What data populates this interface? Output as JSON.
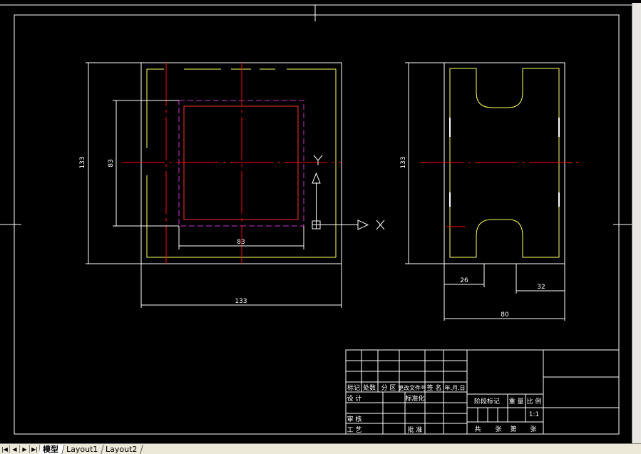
{
  "drawing": {
    "front_view": {
      "dim_height": "133",
      "dim_inner_height": "83",
      "dim_inner_width": "83",
      "dim_width": "133",
      "ucs_y": "Y",
      "ucs_x": "X"
    },
    "side_view": {
      "dim_height": "133",
      "dim_left": "26",
      "dim_right": "32",
      "dim_total": "80"
    }
  },
  "title_block": {
    "rev_headers": [
      "标记",
      "处数",
      "分 区",
      "更改文件号",
      "签 名",
      "年.月.日"
    ],
    "row_design": "设 计",
    "row_standard": "标准化",
    "row_review": "审 核",
    "row_process": "工 艺",
    "row_approve": "批 准",
    "stage_label": "阶段标记",
    "weight_label": "重 量",
    "scale_label": "比 例",
    "scale_value": "1:1",
    "sheet_total": "共",
    "sheet_unit1": "张",
    "sheet_no": "第",
    "sheet_unit2": "张"
  },
  "tabs": {
    "items": [
      "模型",
      "Layout1",
      "Layout2"
    ],
    "active": "模型"
  },
  "colors": {
    "background": "#000000",
    "outline": "#ffffff",
    "part": "#ffff66",
    "center": "#ff0000",
    "hidden": "#cc33cc"
  }
}
